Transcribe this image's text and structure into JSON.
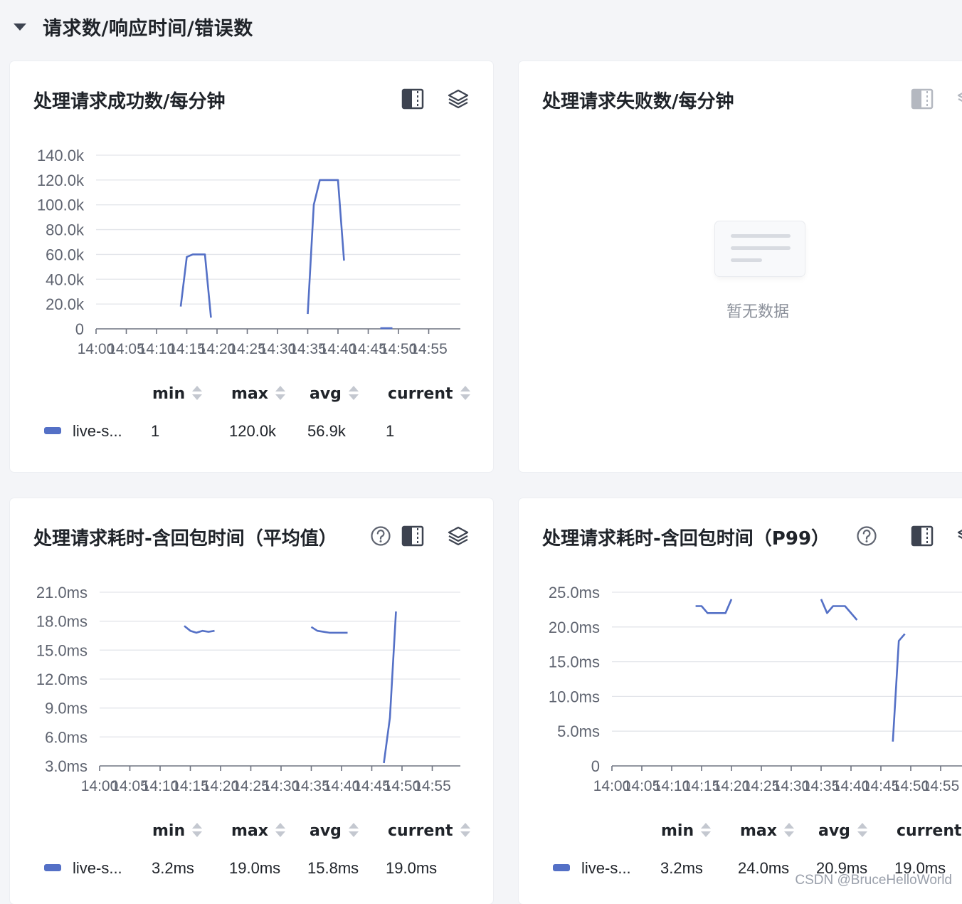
{
  "section": {
    "title": "请求数/响应时间/错误数"
  },
  "colors": {
    "series": "#5470c6",
    "grid": "#e3e5ea",
    "axis": "#5f6470"
  },
  "legend_headers": {
    "min": "min",
    "max": "max",
    "avg": "avg",
    "current": "current"
  },
  "x_ticks": [
    "14:00",
    "14:05",
    "14:10",
    "14:15",
    "14:20",
    "14:25",
    "14:30",
    "14:35",
    "14:40",
    "14:45",
    "14:50",
    "14:55"
  ],
  "panels": [
    {
      "title": "处理请求成功数/每分钟",
      "icons": [
        "split-view-icon",
        "layers-icon"
      ],
      "chart_data": {
        "type": "line",
        "x_unit": "minute",
        "yticks": [
          "140.0k",
          "120.0k",
          "100.0k",
          "80.0k",
          "60.0k",
          "40.0k",
          "20.0k",
          "0"
        ],
        "ylim": [
          0,
          140000
        ],
        "series": [
          {
            "name": "live-s...",
            "segments": [
              [
                [
                  14.0,
                  18000
                ],
                [
                  15.0,
                  58000
                ],
                [
                  16.0,
                  60000
                ],
                [
                  18.0,
                  60000
                ],
                [
                  19.0,
                  9000
                ]
              ],
              [
                [
                  35.0,
                  12000
                ],
                [
                  36.0,
                  100000
                ],
                [
                  37.0,
                  120000
                ],
                [
                  40.0,
                  120000
                ],
                [
                  41.0,
                  55000
                ]
              ],
              [
                [
                  47.0,
                  500
                ],
                [
                  49.0,
                  500
                ]
              ]
            ]
          }
        ]
      },
      "legend": {
        "name": "live-s...",
        "min": "1",
        "max": "120.0k",
        "avg": "56.9k",
        "current": "1"
      }
    },
    {
      "title": "处理请求失败数/每分钟",
      "icons": [
        "split-view-icon"
      ],
      "empty_text": "暂无数据"
    },
    {
      "title": "处理请求耗时-含回包时间（平均值）",
      "icons": [
        "help-icon",
        "split-view-icon",
        "layers-icon"
      ],
      "chart_data": {
        "type": "line",
        "x_unit": "minute",
        "yticks": [
          "21.0ms",
          "18.0ms",
          "15.0ms",
          "12.0ms",
          "9.0ms",
          "6.0ms",
          "3.0ms"
        ],
        "ylim": [
          3,
          21
        ],
        "series": [
          {
            "name": "live-s...",
            "segments": [
              [
                [
                  14.0,
                  17.5
                ],
                [
                  15.0,
                  17.0
                ],
                [
                  16.0,
                  16.8
                ],
                [
                  17.0,
                  17.0
                ],
                [
                  18.0,
                  16.9
                ],
                [
                  19.0,
                  17.0
                ]
              ],
              [
                [
                  35.0,
                  17.4
                ],
                [
                  36.0,
                  17.0
                ],
                [
                  38.0,
                  16.8
                ],
                [
                  41.0,
                  16.8
                ]
              ],
              [
                [
                  47.0,
                  3.3
                ],
                [
                  48.0,
                  8.0
                ],
                [
                  49.0,
                  19.0
                ]
              ]
            ]
          }
        ]
      },
      "legend": {
        "name": "live-s...",
        "min": "3.2ms",
        "max": "19.0ms",
        "avg": "15.8ms",
        "current": "19.0ms"
      }
    },
    {
      "title": "处理请求耗时-含回包时间（P99）",
      "icons": [
        "help-icon",
        "split-view-icon"
      ],
      "chart_data": {
        "type": "line",
        "x_unit": "minute",
        "yticks": [
          "25.0ms",
          "20.0ms",
          "15.0ms",
          "10.0ms",
          "5.0ms",
          "0"
        ],
        "ylim": [
          0,
          25
        ],
        "series": [
          {
            "name": "live-s...",
            "segments": [
              [
                [
                  14.0,
                  23.0
                ],
                [
                  15.0,
                  23.0
                ],
                [
                  16.0,
                  22.0
                ],
                [
                  19.0,
                  22.0
                ],
                [
                  20.0,
                  24.0
                ]
              ],
              [
                [
                  35.0,
                  24.0
                ],
                [
                  36.0,
                  22.0
                ],
                [
                  37.0,
                  23.0
                ],
                [
                  39.0,
                  23.0
                ],
                [
                  41.0,
                  21.0
                ]
              ],
              [
                [
                  47.0,
                  3.5
                ],
                [
                  48.0,
                  18.0
                ],
                [
                  49.0,
                  19.0
                ]
              ]
            ]
          }
        ]
      },
      "legend": {
        "name": "live-s...",
        "min": "3.2ms",
        "max": "24.0ms",
        "avg": "20.9ms",
        "current": "19.0ms"
      }
    }
  ],
  "watermark": "CSDN @BruceHelloWorld"
}
